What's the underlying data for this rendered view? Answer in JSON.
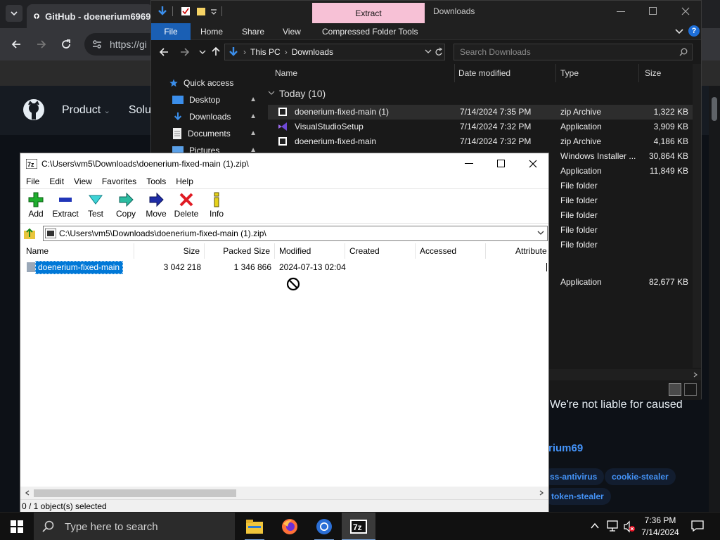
{
  "browser": {
    "tab_title": "GitHub - doenerium6969/",
    "url": "https://gi",
    "nav": [
      "Product",
      "Solut"
    ],
    "colors": {
      "bg": "#0d1117",
      "tab": "#35363a",
      "link": "#4493f8"
    }
  },
  "github": {
    "disclaimer": "We're not liable for caused",
    "owner_fragment": "rium69",
    "topics": [
      "ss-antivirus",
      "cookie-stealer",
      "token-stealer"
    ]
  },
  "explorer": {
    "title": "Downloads",
    "extract_tab": "Extract",
    "ribbon_tabs": [
      "File",
      "Home",
      "Share",
      "View",
      "Compressed Folder Tools"
    ],
    "breadcrumb": [
      "This PC",
      "Downloads"
    ],
    "search_placeholder": "Search Downloads",
    "nav": {
      "quick_access": "Quick access",
      "items": [
        "Desktop",
        "Downloads",
        "Documents",
        "Pictures"
      ]
    },
    "columns": [
      "Name",
      "Date modified",
      "Type",
      "Size"
    ],
    "group": "Today (10)",
    "files": [
      {
        "name": "doenerium-fixed-main (1)",
        "date": "7/14/2024 7:35 PM",
        "type": "zip Archive",
        "size": "1,322 KB"
      },
      {
        "name": "VisualStudioSetup",
        "date": "7/14/2024 7:32 PM",
        "type": "Application",
        "size": "3,909 KB"
      },
      {
        "name": "doenerium-fixed-main",
        "date": "7/14/2024 7:32 PM",
        "type": "zip Archive",
        "size": "4,186 KB"
      },
      {
        "name": "",
        "date": "",
        "type": "Windows Installer ...",
        "size": "30,864 KB"
      },
      {
        "name": "",
        "date": "",
        "type": "Application",
        "size": "11,849 KB"
      },
      {
        "name": "",
        "date": "",
        "type": "File folder",
        "size": ""
      },
      {
        "name": "",
        "date": "",
        "type": "File folder",
        "size": ""
      },
      {
        "name": "",
        "date": "",
        "type": "File folder",
        "size": ""
      },
      {
        "name": "",
        "date": "",
        "type": "File folder",
        "size": ""
      },
      {
        "name": "",
        "date": "",
        "type": "File folder",
        "size": ""
      },
      {
        "name": "",
        "date": "",
        "type": "Application",
        "size": "82,677 KB"
      }
    ]
  },
  "sevenzip": {
    "title": "C:\\Users\\vm5\\Downloads\\doenerium-fixed-main (1).zip\\",
    "menu": [
      "File",
      "Edit",
      "View",
      "Favorites",
      "Tools",
      "Help"
    ],
    "toolbar": [
      "Add",
      "Extract",
      "Test",
      "Copy",
      "Move",
      "Delete",
      "Info"
    ],
    "path": "C:\\Users\\vm5\\Downloads\\doenerium-fixed-main (1).zip\\",
    "columns": [
      "Name",
      "Size",
      "Packed Size",
      "Modified",
      "Created",
      "Accessed",
      "Attribute"
    ],
    "row": {
      "name": "doenerium-fixed-main",
      "size": "3 042 218",
      "packed": "1 346 866",
      "modified": "2024-07-13 02:04"
    },
    "status": "0 / 1 object(s) selected"
  },
  "taskbar": {
    "search_placeholder": "Type here to search",
    "time": "7:36 PM",
    "date": "7/14/2024"
  }
}
